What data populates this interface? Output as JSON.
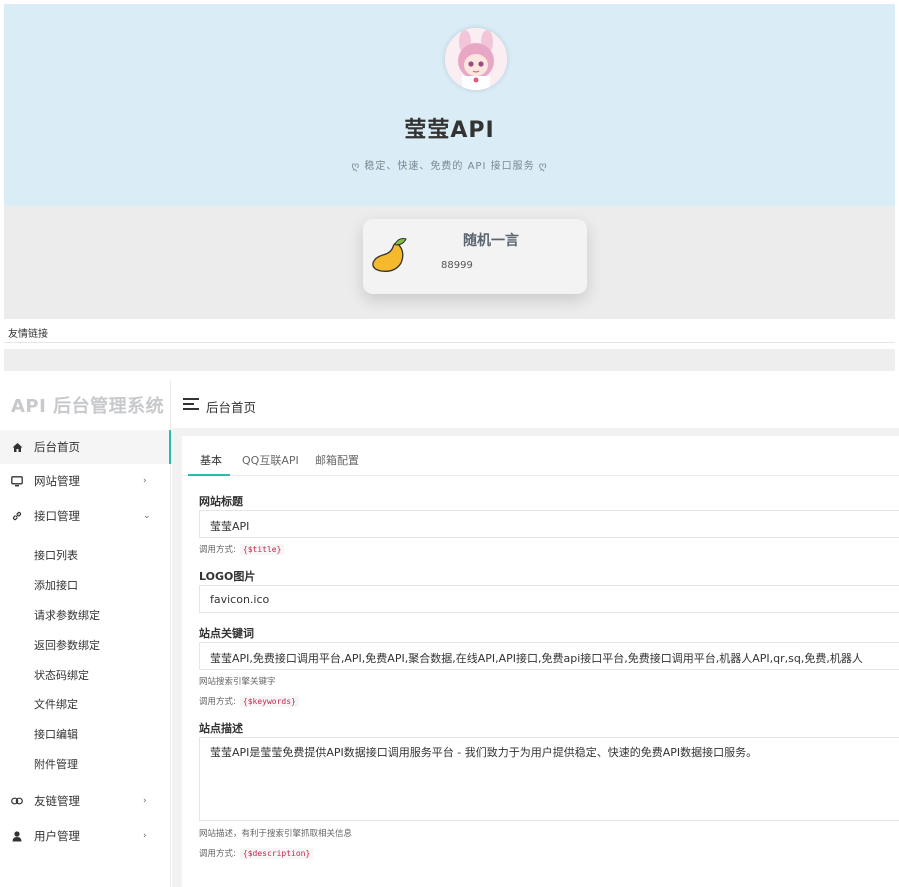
{
  "site": {
    "title": "莹莹API",
    "subtitle": "ღ 稳定、快速、免费的 API 接口服务 ღ",
    "avatar_icon": "anime-girl-avatar-icon"
  },
  "quote_card": {
    "icon": "mango-icon",
    "title": "随机一言",
    "text": "88999"
  },
  "links": {
    "label": "友情链接"
  },
  "admin": {
    "brand": "API 后台管理系统",
    "topbar_title": "后台首页",
    "accent_color": "#2bbbad",
    "sidebar": {
      "items": [
        {
          "label": "后台首页",
          "icon": "home-icon"
        },
        {
          "label": "网站管理",
          "icon": "monitor-icon"
        },
        {
          "label": "接口管理",
          "icon": "link-icon"
        },
        {
          "label": "友链管理",
          "icon": "chain-icon"
        },
        {
          "label": "用户管理",
          "icon": "user-icon"
        }
      ],
      "subitems": [
        "接口列表",
        "添加接口",
        "请求参数绑定",
        "返回参数绑定",
        "状态码绑定",
        "文件绑定",
        "接口编辑",
        "附件管理"
      ]
    },
    "tabs": [
      "基本",
      "QQ互联API",
      "邮箱配置"
    ],
    "form": {
      "title_label": "网站标题",
      "title_value": "莹莹API",
      "title_hint": "调用方式:",
      "title_code": "{$title}",
      "logo_label": "LOGO图片",
      "logo_value": "favicon.ico",
      "keywords_label": "站点关键词",
      "keywords_value": "莹莹API,免费接口调用平台,API,免费API,聚合数据,在线API,API接口,免费api接口平台,免费接口调用平台,机器人API,qr,sq,免费,机器人",
      "keywords_help": "网站搜索引擎关键字",
      "keywords_hint": "调用方式:",
      "keywords_code": "{$keywords}",
      "desc_label": "站点描述",
      "desc_value": "莹莹API是莹莹免费提供API数据接口调用服务平台 - 我们致力于为用户提供稳定、快速的免费API数据接口服务。",
      "desc_help": "网站描述，有利于搜索引擎抓取相关信息",
      "desc_hint": "调用方式:",
      "desc_code": "{$description}"
    }
  }
}
